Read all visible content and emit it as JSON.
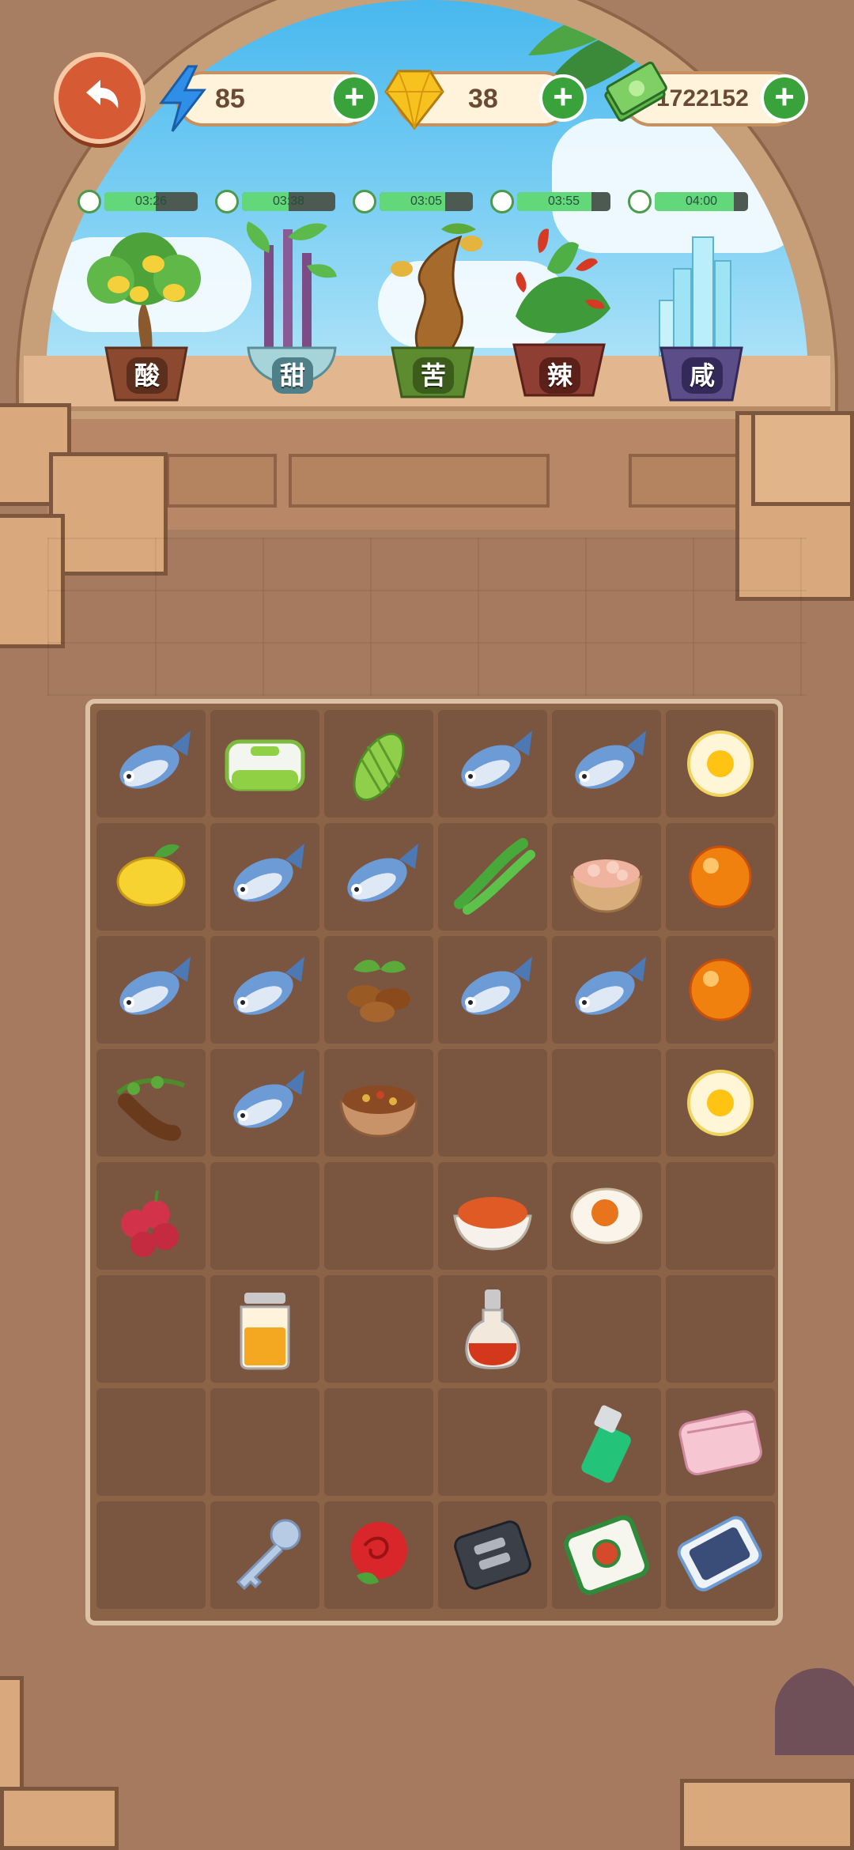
{
  "hud": {
    "energy": "85",
    "gems": "38",
    "cash": "1722152"
  },
  "plants": [
    {
      "label": "酸",
      "timer": "03:26",
      "progress": 0.55,
      "color": "#8b4a2f"
    },
    {
      "label": "甜",
      "timer": "03:38",
      "progress": 0.5,
      "color": "#6fa6b0"
    },
    {
      "label": "苦",
      "timer": "03:05",
      "progress": 0.7,
      "color": "#5d8b2f"
    },
    {
      "label": "辣",
      "timer": "03:55",
      "progress": 0.8,
      "color": "#8e3e32"
    },
    {
      "label": "咸",
      "timer": "04:00",
      "progress": 0.85,
      "color": "#5b4d88"
    }
  ],
  "board": {
    "rows": [
      [
        "fish",
        "lunchbox",
        "bitter-melon",
        "fish",
        "fish",
        "fried-egg"
      ],
      [
        "lemon",
        "fish",
        "fish",
        "green-chili",
        "minced-meat",
        "orange-gem"
      ],
      [
        "fish",
        "fish",
        "coffee-beans",
        "fish",
        "fish",
        "orange-gem"
      ],
      [
        "tamarind",
        "fish",
        "mixed-spices",
        "",
        "",
        "fried-egg"
      ],
      [
        "lychee",
        "",
        "",
        "chili-powder",
        "salted-egg",
        ""
      ],
      [
        "",
        "honey-jar",
        "",
        "sauce-bottle",
        "",
        ""
      ],
      [
        "",
        "",
        "",
        "",
        "lighter",
        "pink-wallet"
      ],
      [
        "",
        "key",
        "rose",
        "car-key",
        "mahjong-tile",
        "smartphone"
      ]
    ]
  }
}
